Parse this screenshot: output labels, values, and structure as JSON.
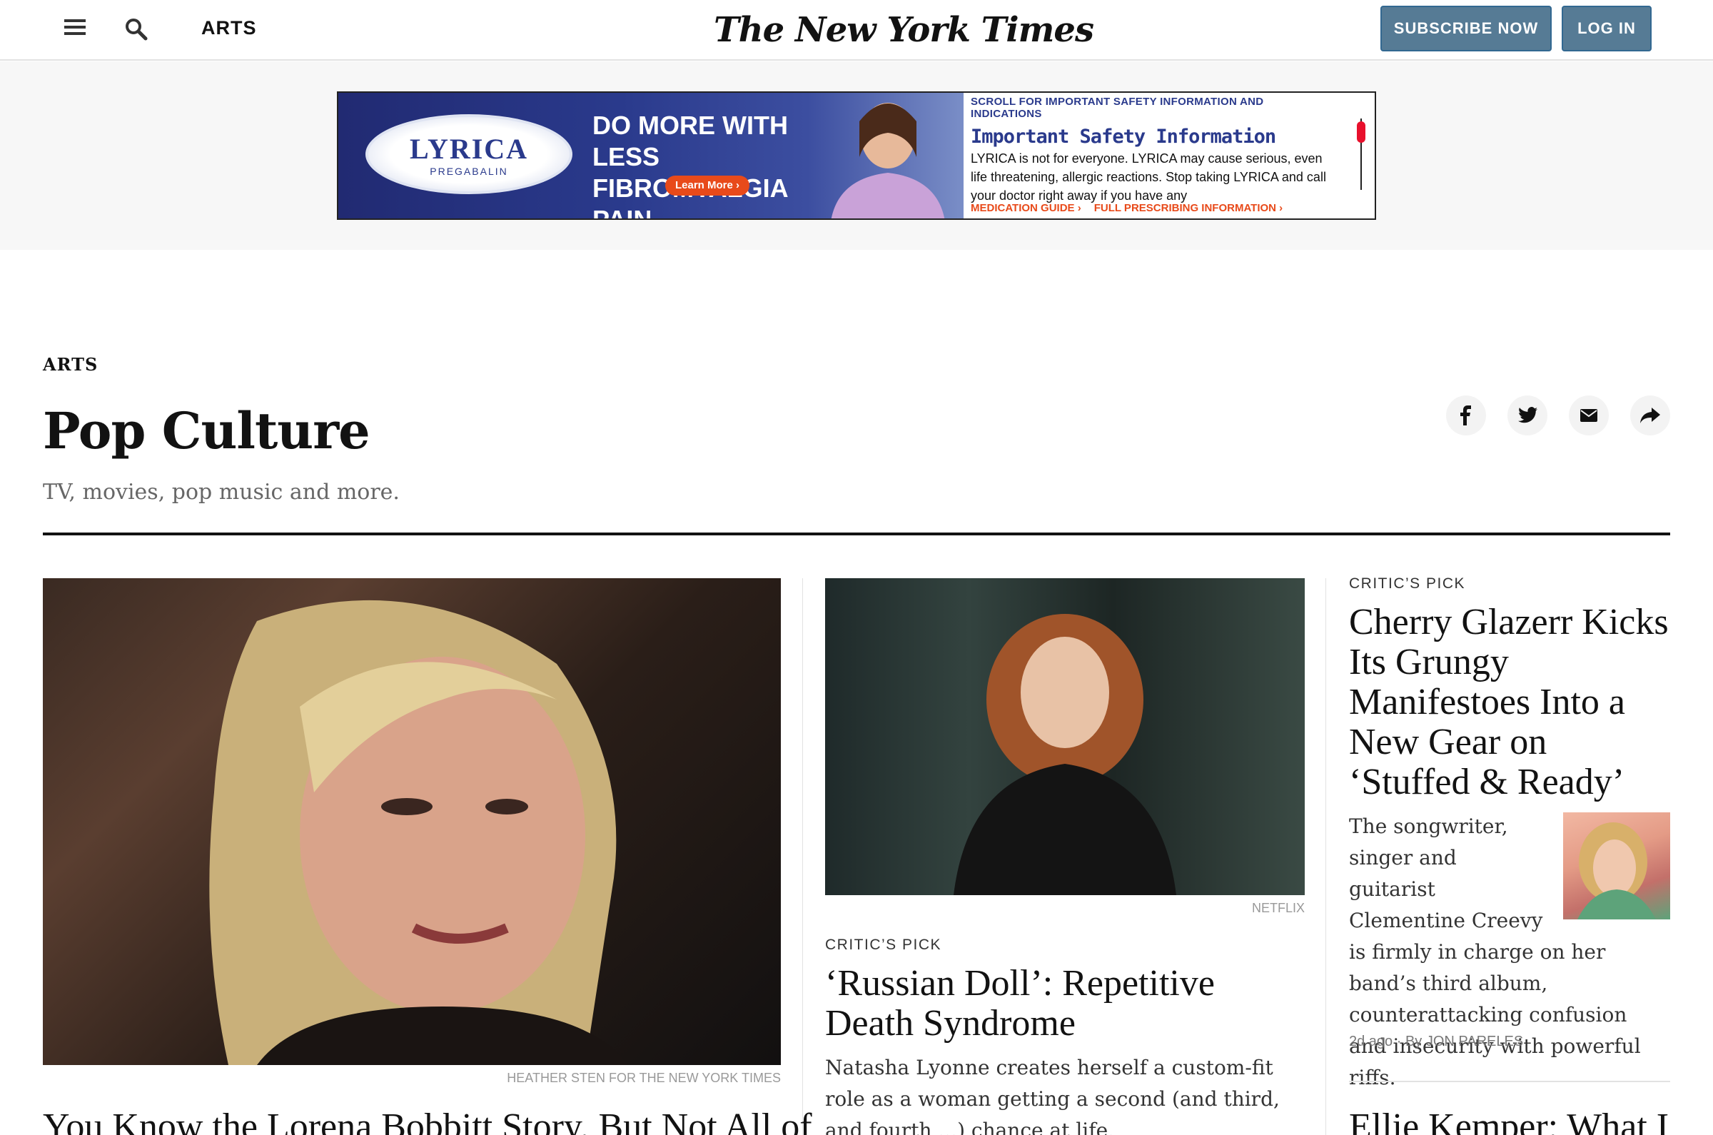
{
  "header": {
    "section_label": "ARTS",
    "logo": "The New York Times",
    "subscribe_label": "SUBSCRIBE NOW",
    "login_label": "LOG IN"
  },
  "ad": {
    "brand": "LYRICA",
    "brand_sub": "PREGABALIN",
    "headline": "DO MORE WITH LESS FIBROMYALGIA PAIN.",
    "learn_more": "Learn More ›",
    "scroll_note": "SCROLL FOR IMPORTANT SAFETY INFORMATION AND INDICATIONS",
    "isi_title": "Important Safety Information",
    "isi_text": "LYRICA is not for everyone. LYRICA may cause serious, even life threatening, allergic reactions. Stop taking LYRICA and call your doctor right away if you have any",
    "link_guide": "MEDICATION GUIDE ›",
    "link_pi": "FULL PRESCRIBING INFORMATION ›"
  },
  "section": {
    "kicker": "ARTS",
    "title": "Pop Culture",
    "description": "TV, movies, pop music and more."
  },
  "lead": {
    "credit": "HEATHER STEN FOR THE NEW YORK TIMES",
    "headline": "You Know the Lorena Bobbitt Story. But Not All of"
  },
  "middle": {
    "credit": "NETFLIX",
    "label": "CRITIC’S PICK",
    "headline": "‘Russian Doll’: Repetitive Death Syndrome",
    "summary": "Natasha Lyonne creates herself a custom-fit role as a woman getting a second (and third, and fourth ...) chance at life."
  },
  "right": {
    "label": "CRITIC’S PICK",
    "headline": "Cherry Glazerr Kicks Its Grungy Manifestoes Into a New Gear on ‘Stuffed & Ready’",
    "summary": "The songwriter, singer and guitarist Clementine Creevy is firmly in charge on her band’s third album, counterattacking confusion and insecurity with powerful riffs.",
    "time": "2d ago",
    "author": "By JON PARELES",
    "next_headline": "Ellie Kemper: What I"
  },
  "colors": {
    "button_bg": "#567b95",
    "ad_accent": "#e84a1a",
    "ad_blue": "#2a3a8c"
  }
}
